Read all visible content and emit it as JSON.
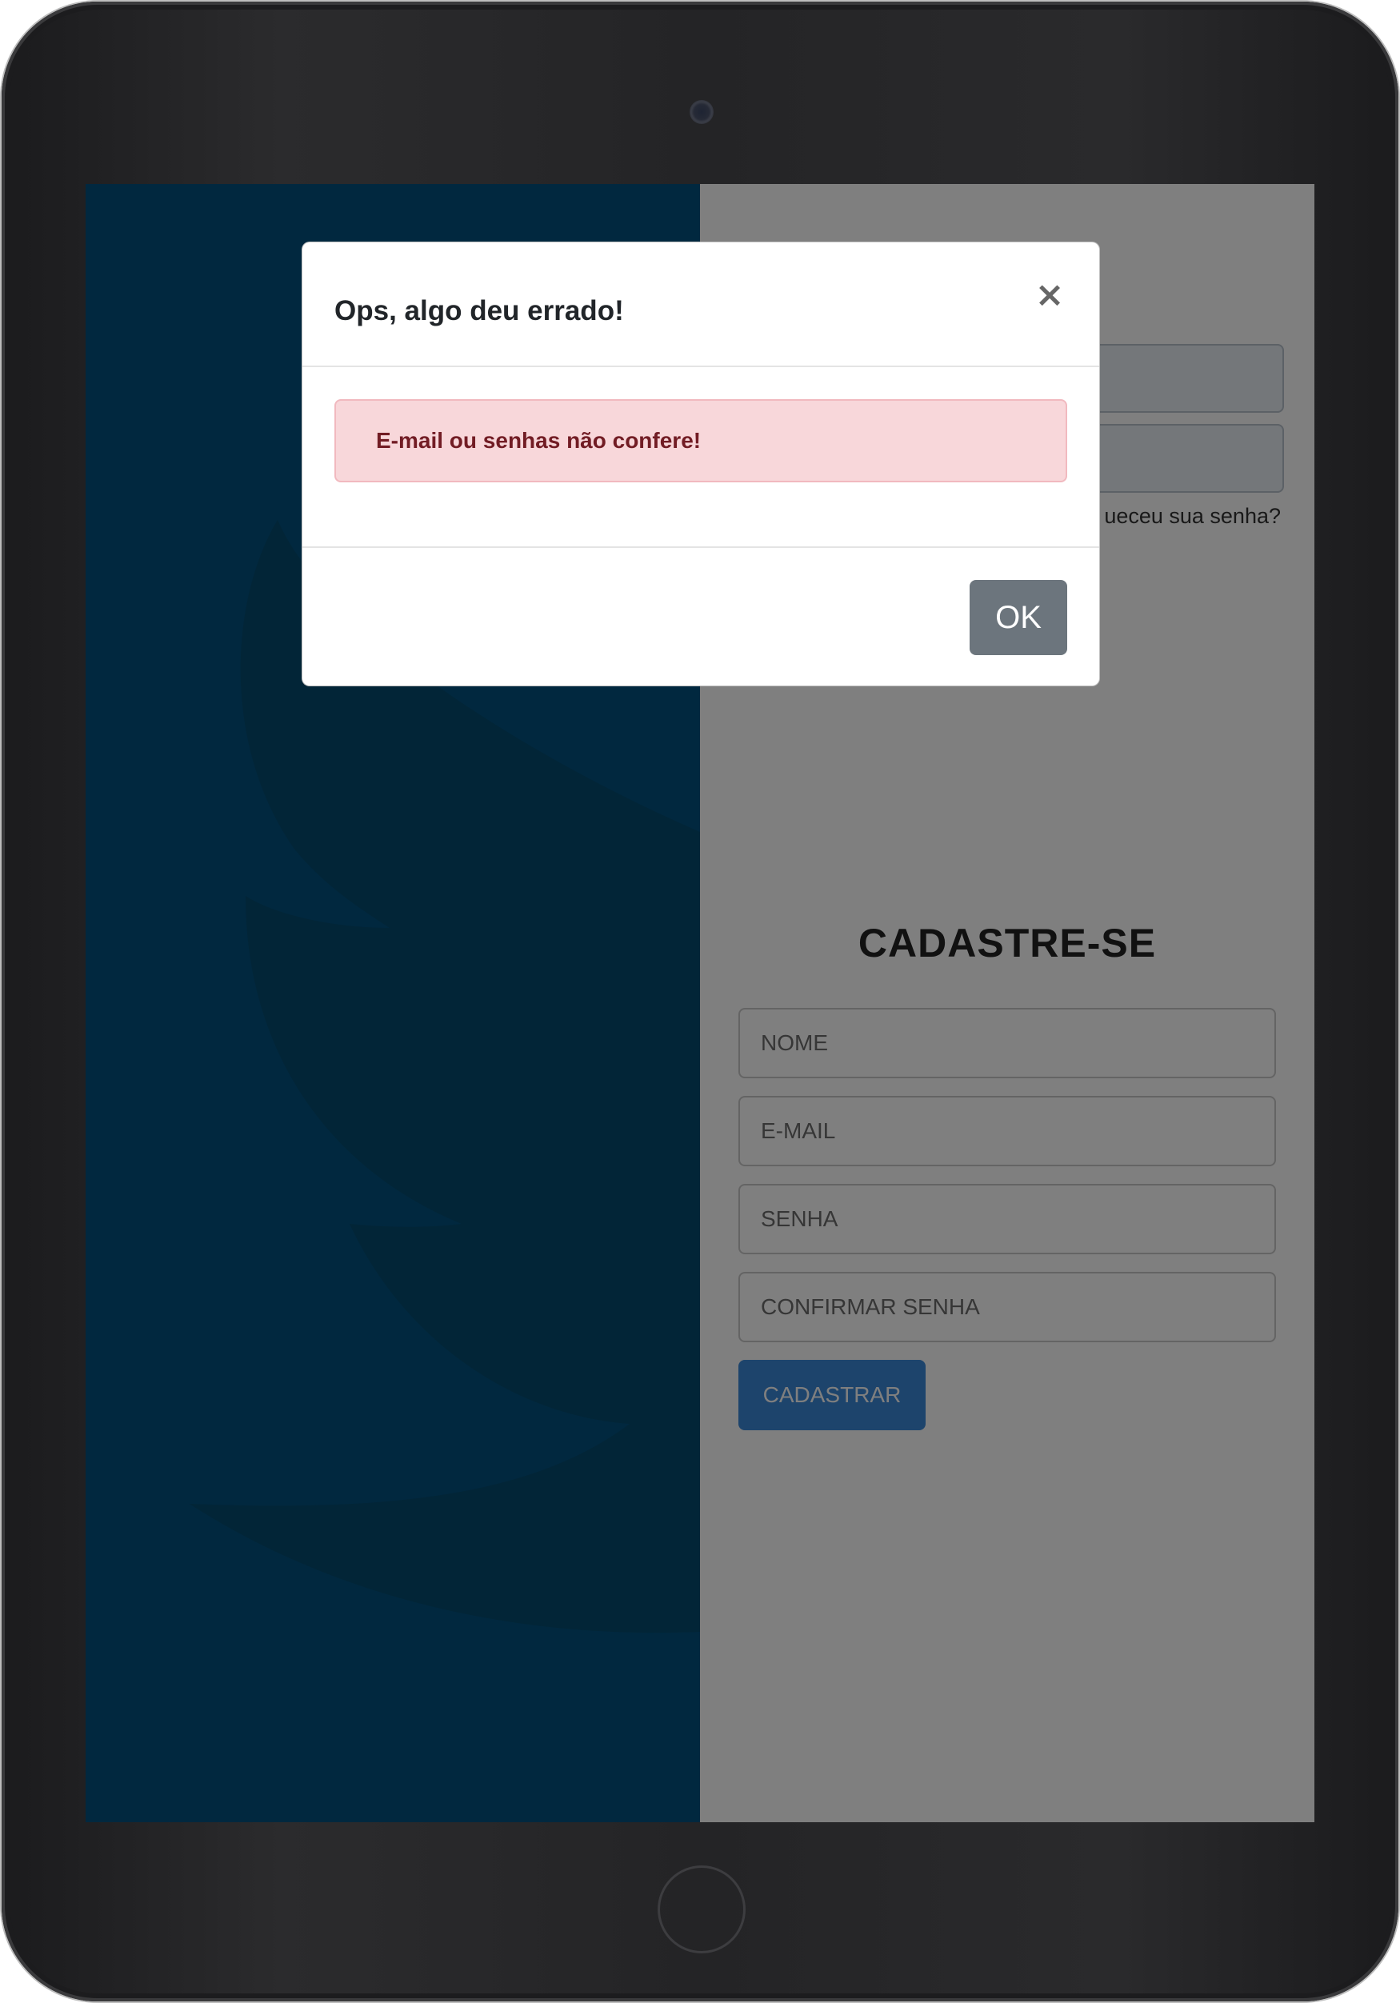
{
  "background": {
    "accent_color": "#02507e"
  },
  "login": {
    "forgot_password_text": "ueceu sua senha?"
  },
  "signup": {
    "title": "CADASTRE-SE",
    "name_placeholder": "NOME",
    "email_placeholder": "E-MAIL",
    "password_placeholder": "SENHA",
    "confirm_password_placeholder": "CONFIRMAR SENHA",
    "submit_label": "CADASTRAR",
    "submit_color": "#3b88d8"
  },
  "modal": {
    "title": "Ops, algo deu errado!",
    "close_symbol": "×",
    "error_message": "E-mail ou senhas não confere!",
    "ok_label": "OK"
  },
  "device": {
    "type": "tablet",
    "icons": [
      "camera-icon",
      "home-button-icon"
    ]
  }
}
